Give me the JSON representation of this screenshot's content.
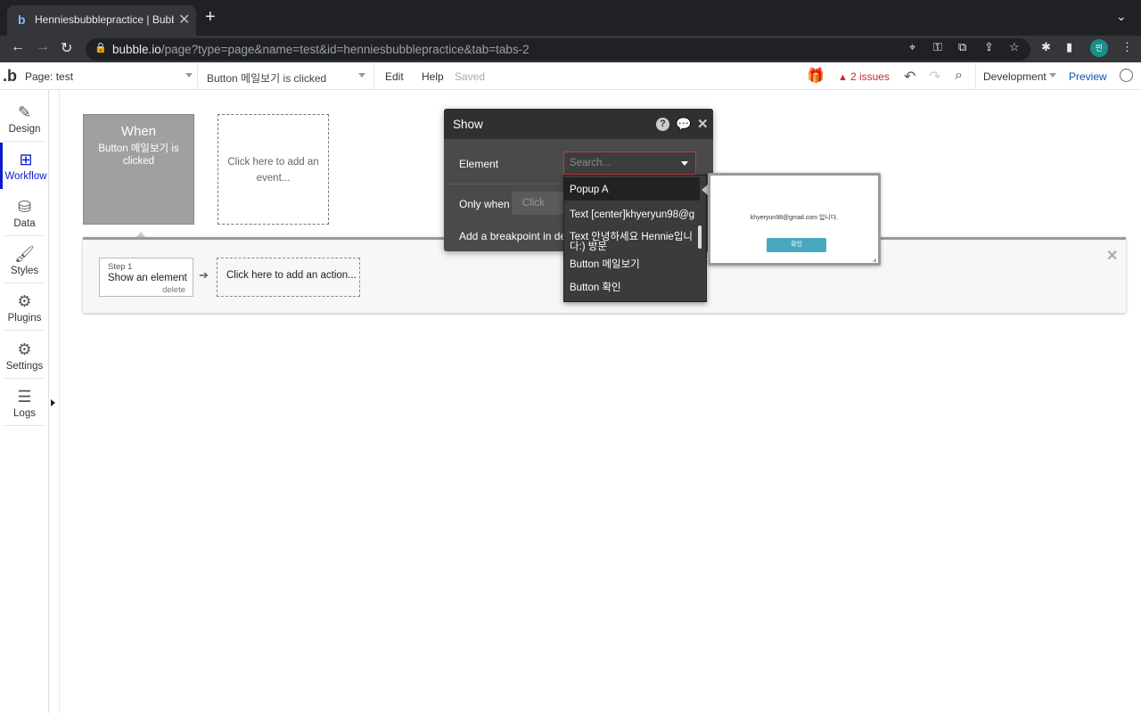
{
  "browser": {
    "tab_title": "Henniesbubblepractice | Bubble",
    "tab_favicon": "b",
    "url_host": "bubble.io",
    "url_path": "/page?type=page&name=test&id=henniesbubblepractice&tab=tabs-2",
    "profile_initial": "민"
  },
  "topbar": {
    "logo": ".b",
    "page_selector": "Page: test",
    "event_selector": "Button 메일보기 is clicked",
    "menu_edit": "Edit",
    "menu_help": "Help",
    "saved_status": "Saved",
    "issues": "2 issues",
    "environment": "Development",
    "preview": "Preview"
  },
  "sidebar": {
    "items": [
      {
        "label": "Design",
        "icon": "design-icon"
      },
      {
        "label": "Workflow",
        "icon": "workflow-icon"
      },
      {
        "label": "Data",
        "icon": "data-icon"
      },
      {
        "label": "Styles",
        "icon": "styles-icon"
      },
      {
        "label": "Plugins",
        "icon": "plugins-icon"
      },
      {
        "label": "Settings",
        "icon": "settings-icon"
      },
      {
        "label": "Logs",
        "icon": "logs-icon"
      }
    ]
  },
  "workflow": {
    "when_title": "When",
    "when_desc": "Button 메일보기 is clicked",
    "add_event": "Click here to add an event...",
    "step_number": "Step 1",
    "step_title": "Show an element",
    "step_delete": "delete",
    "add_action": "Click here to add an action..."
  },
  "dialog": {
    "title": "Show",
    "element_label": "Element",
    "element_placeholder": "Search...",
    "only_when_label": "Only when",
    "only_when_value": "Click",
    "breakpoint_label": "Add a breakpoint in debug mode"
  },
  "dropdown": {
    "options": [
      "Popup A",
      "Text [center]khyeryun98@g",
      "Text 안녕하세요 Hennie입니다:) 방문",
      "Button 메일보기",
      "Button 확인"
    ]
  },
  "thumbnail": {
    "text": "khyeryun98@gmail.com 입니다.",
    "button": "확인"
  },
  "colors": {
    "accent": "#0a1bd0",
    "issues_red": "#d0252d",
    "preview_blue": "#0a4fb8",
    "dialog_bg": "#4a4a4a",
    "thumb_button": "#49a8bf"
  }
}
